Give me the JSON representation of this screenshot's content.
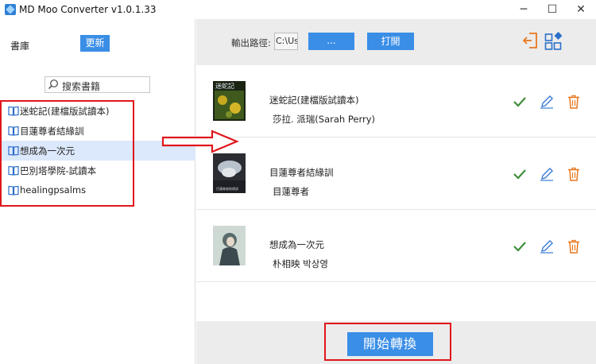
{
  "window": {
    "title": "MD Moo Converter v1.0.1.33",
    "min_glyph": "─",
    "max_glyph": "☐",
    "close_glyph": "✕"
  },
  "sidebar": {
    "library_label": "書庫",
    "refresh_label": "更新",
    "search_placeholder": "搜索書籍",
    "items": [
      {
        "label": "迷蛇記(建檔版試讀本)",
        "selected": false
      },
      {
        "label": "目蓮尊者結緣訓",
        "selected": false
      },
      {
        "label": "想成為一次元",
        "selected": true
      },
      {
        "label": "巴別塔學院-試讀本",
        "selected": false
      },
      {
        "label": "healingpsalms",
        "selected": false
      }
    ]
  },
  "toolbar": {
    "output_path_label": "輸出路徑:",
    "output_path_value": "C:\\Us",
    "browse_label": "...",
    "open_label": "打開"
  },
  "books": [
    {
      "title": "迷蛇記(建檔版試讀本)",
      "author": "莎拉. 派瑞(Sarah Perry)",
      "cover_text": "迷蛇記"
    },
    {
      "title": "目蓮尊者結緣訓",
      "author": "目蓮尊者",
      "cover_text": "目蓮尊者結緣訓"
    },
    {
      "title": "想成為一次元",
      "author": "朴相映 박상영",
      "cover_text": ""
    }
  ],
  "footer": {
    "start_label": "開始轉換"
  },
  "colors": {
    "accent": "#3a8ee6",
    "check": "#3f8f3a",
    "edit": "#3a7bd5",
    "trash": "#e8771e",
    "highlight": "#e0161b"
  }
}
